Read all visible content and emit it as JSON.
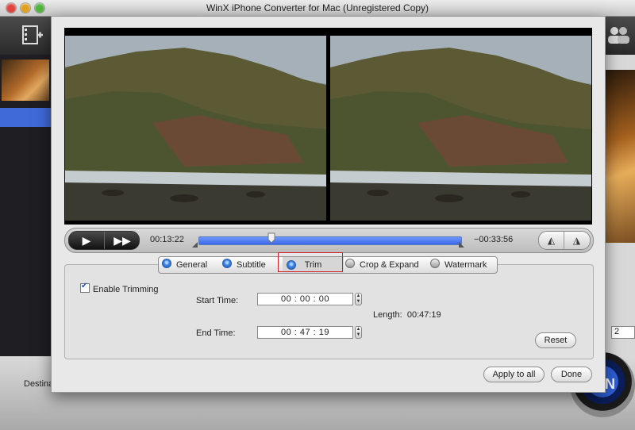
{
  "window": {
    "title": "WinX iPhone Converter for Mac (Unregistered Copy)"
  },
  "icons": {
    "add_video": "film-add-icon",
    "play": "play-icon",
    "fast_forward": "fast-forward-icon",
    "flip_h": "flip-horizontal-icon",
    "flip_v": "flip-vertical-icon"
  },
  "player": {
    "play_glyph": "▶",
    "ff_glyph": "▶▶",
    "current_time": "00:13:22",
    "remaining_time": "−00:33:56",
    "progress": 0.28,
    "flip_h_glyph": "◭",
    "flip_v_glyph": "◮"
  },
  "tabs": {
    "general": "General",
    "subtitle": "Subtitle",
    "trim": "Trim",
    "crop": "Crop & Expand",
    "watermark": "Watermark",
    "selected": "Trim"
  },
  "trim": {
    "enable_label": "Enable Trimming",
    "enabled": true,
    "start_label": "Start Time:",
    "start_value": "00 : 00 : 00",
    "end_label": "End Time:",
    "end_value": "00 : 47 : 19",
    "length_label": "Length:",
    "length_value": "00:47:19"
  },
  "buttons": {
    "reset": "Reset",
    "apply_all": "Apply to all",
    "done": "Done"
  },
  "background": {
    "destination_label": "Destina",
    "right_field_value": "2",
    "run_glyph": "N"
  },
  "colors": {
    "accent": "#3b67e5",
    "highlight": "#d21f26"
  }
}
